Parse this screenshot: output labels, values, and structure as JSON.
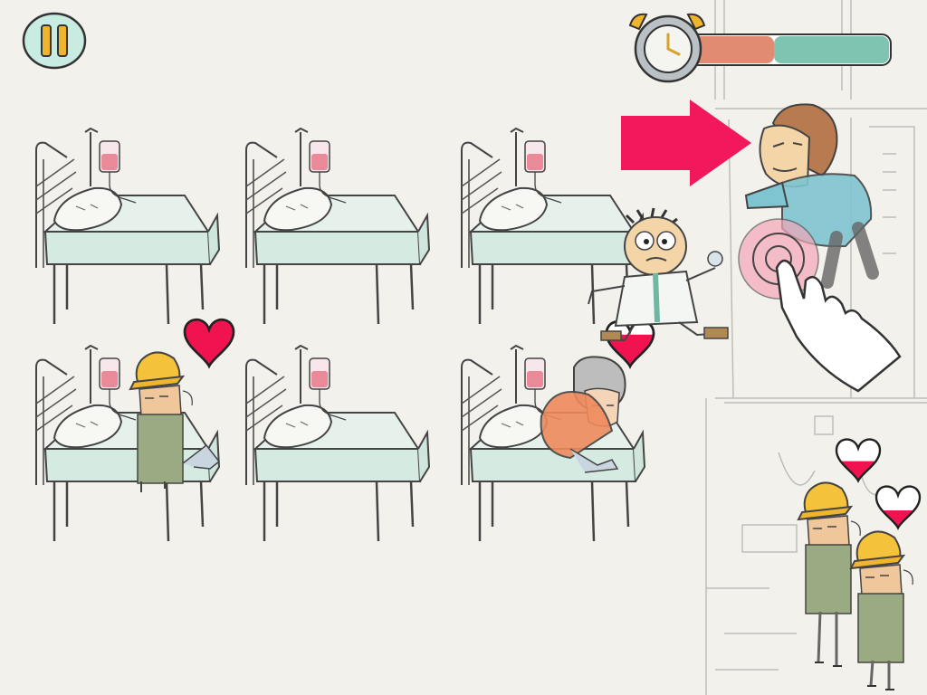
{
  "game": {
    "name": "hospital-bed-management",
    "hud": {
      "pause_icon": "pause-icon",
      "timer_icon": "alarm-clock-icon",
      "time_remaining": 0.55,
      "timer_colors": {
        "elapsed": "#e08b72",
        "remaining": "#7fc4b1"
      }
    },
    "beds": [
      {
        "id": "bed-1",
        "occupied": false
      },
      {
        "id": "bed-2",
        "occupied": false
      },
      {
        "id": "bed-3",
        "occupied": false
      },
      {
        "id": "bed-4",
        "occupied": true,
        "patient": "kid-yellow-cap",
        "health": 1.0
      },
      {
        "id": "bed-5",
        "occupied": false
      },
      {
        "id": "bed-6",
        "occupied": true,
        "patient": "old-lady",
        "health": 0.75
      }
    ],
    "doctor": {
      "icon": "doctor-icon",
      "status": "moving"
    },
    "tutorial": {
      "arrow_icon": "arrow-right-icon",
      "hand_icon": "hand-tap-icon",
      "target_icon": "tap-target-icon"
    },
    "incoming_patient": {
      "icon": "man-at-entrance-icon"
    },
    "waiting_queue": [
      {
        "id": "waiting-1",
        "patient": "kid-yellow-cap",
        "health": 0.5
      },
      {
        "id": "waiting-2",
        "patient": "kid-yellow-cap",
        "health": 0.4
      }
    ],
    "colors": {
      "heart": "#f0134f",
      "arrow": "#f2185c",
      "bed_sheet": "#ddeee6",
      "iv_fluid": "#e8788a",
      "background": "#f3f1ec"
    }
  }
}
